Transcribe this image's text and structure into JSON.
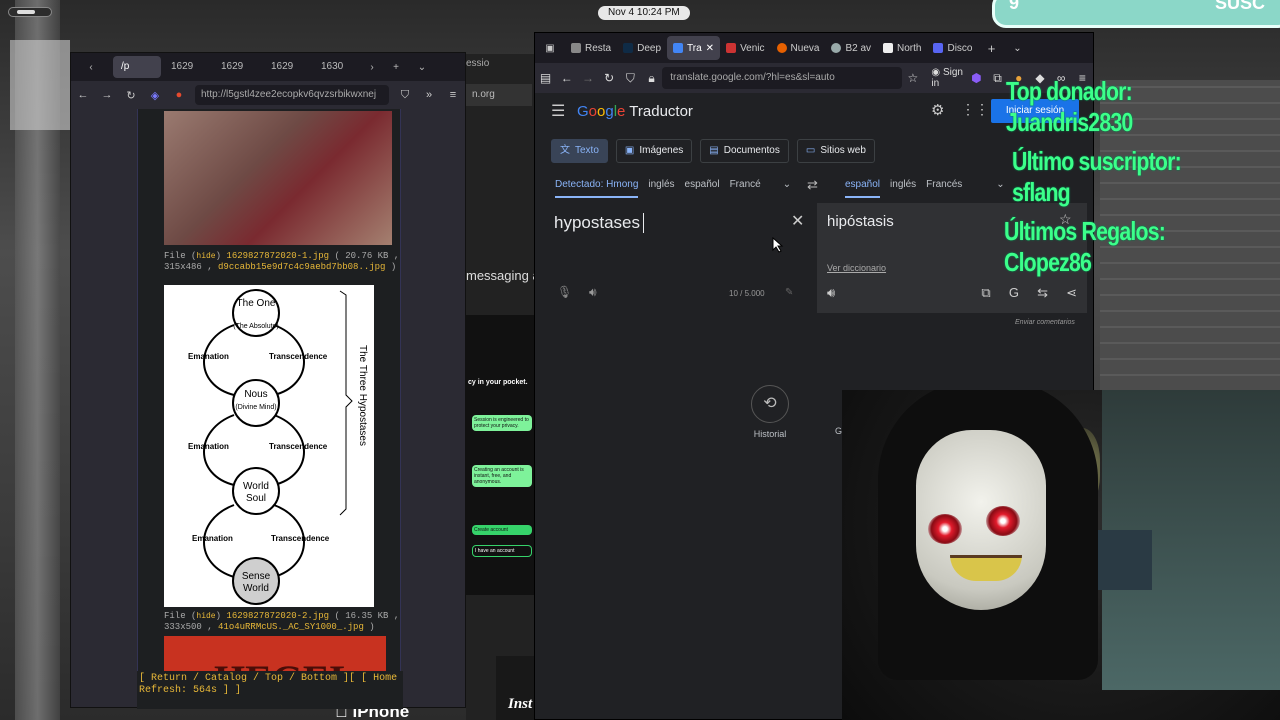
{
  "topbar": {
    "clock": "Nov 4  10:24 PM",
    "banner_left": "9",
    "banner_right": "SUSC"
  },
  "left_browser": {
    "tabs": [
      "/p",
      "1629",
      "1629",
      "1629",
      "1630"
    ],
    "url": "http://l5gstl4zee2ecopkv6qvzsrbikwxnej",
    "files": [
      {
        "prefix": "File (",
        "hide": "hide",
        "mid": ") ",
        "name": "1629827872020-1.jpg",
        "meta": " ( 20.76 KB , 315x486 , ",
        "orig": "d9ccabb15e9d7c4c9aebd7bb08..jpg",
        "end": " )"
      },
      {
        "prefix": "File (",
        "hide": "hide",
        "mid": ") ",
        "name": "1629827872020-2.jpg",
        "meta": " ( 16.35 KB , 333x500 , ",
        "orig": "41o4uRRMcUS._AC_SY1000_.jpg",
        "end": " )"
      }
    ],
    "diagram": {
      "one": "The One",
      "one_sub": "(The Absolute)",
      "nous": "Nous",
      "nous_sub": "(Divine Mind)",
      "world_soul_1": "World",
      "world_soul_2": "Soul",
      "sense_1": "Sense",
      "sense_2": "World",
      "emanation": "Emanation",
      "transcendence": "Transcendence",
      "side_label": "The Three Hypostases"
    },
    "img3_text": "HEGEL",
    "footer": {
      "line1": "[ Return / Catalog / Top / Bottom ][ [",
      "home": "Home",
      "line2": "Refresh: 564s ]",
      "close": "]"
    }
  },
  "mid": {
    "tab": "essio",
    "url": "n.org",
    "messaging": "messaging a",
    "pocket": "cy in your pocket.",
    "iphone": "iPhone",
    "inst": "Inst",
    "cards": [
      "Session is engineered to protect your privacy.",
      "Creating an account is instant, free, and anonymous.",
      "Create account",
      "I have an account"
    ]
  },
  "right_browser": {
    "tabs": [
      {
        "label": "Resta",
        "icon": "restore-icon"
      },
      {
        "label": "Deep",
        "icon": "deepl-icon"
      },
      {
        "label": "Tra",
        "icon": "translate-icon"
      },
      {
        "label": "Venic",
        "icon": "venice-icon"
      },
      {
        "label": "Nueva",
        "icon": "firefox-icon"
      },
      {
        "label": "B2 av",
        "icon": "b2-icon"
      },
      {
        "label": "North",
        "icon": "wiki-icon"
      },
      {
        "label": "Disco",
        "icon": "discord-icon"
      }
    ],
    "url": "translate.google.com/?hl=es&sl=auto",
    "sign_in": "Sign in",
    "app_name": "Traductor",
    "login": "Iniciar sesión",
    "modes": [
      "Texto",
      "Imágenes",
      "Documentos",
      "Sitios web"
    ],
    "src_langs": [
      "Detectado: Hmong",
      "inglés",
      "español",
      "Francé"
    ],
    "tgt_langs": [
      "español",
      "inglés",
      "Francés"
    ],
    "source_text": "hypostases",
    "target_text": "hipóstasis",
    "dictionary": "Ver diccionario",
    "count": "10 / 5.000",
    "feedback": "Enviar comentarios",
    "history": "Historial",
    "saved": "G"
  },
  "overlays": {
    "top_donor": "Top donador: Juandris2830",
    "last_sub": "Último suscriptor: sflang",
    "last_gifts": "Últimos Regalos: Clopez86"
  },
  "colors": {
    "accent": "#8ab4f8",
    "overlay": "#3cff8a",
    "button": "#1a73e8"
  }
}
